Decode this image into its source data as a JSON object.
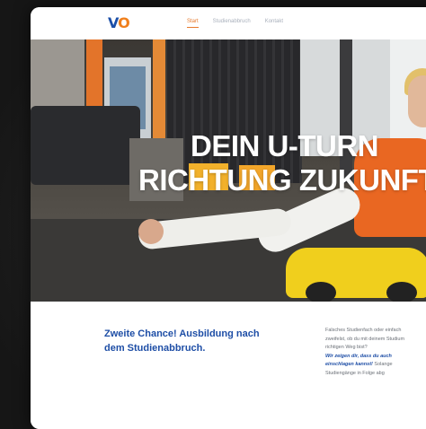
{
  "header": {
    "logo_main": "V",
    "logo_accent": "O",
    "nav": [
      {
        "label": "Start"
      },
      {
        "label": "Studienabbruch"
      },
      {
        "label": "Kontakt"
      }
    ]
  },
  "hero": {
    "headline_line1": "DEIN U-TURN",
    "headline_line2": "RICHTUNG ZUKUNFT"
  },
  "intro": {
    "subheading_line1": "Zweite Chance! Ausbildung nach",
    "subheading_line2": "dem Studienabbruch.",
    "paragraph_line1": "Falsches Studienfach oder einfach",
    "paragraph_line2": "zweifelst, ob du mit deinem Studium",
    "paragraph_line3": "richtigen Weg bist?",
    "emphasis_line1": "Wir zeigen dir, dass du auch",
    "emphasis_line2": "einschlagen kannst!",
    "paragraph_line4": "Solange",
    "paragraph_line5": "Studiengänge in Folge abg"
  },
  "colors": {
    "brand_blue": "#1e4ea6",
    "brand_orange": "#e77a2d"
  }
}
